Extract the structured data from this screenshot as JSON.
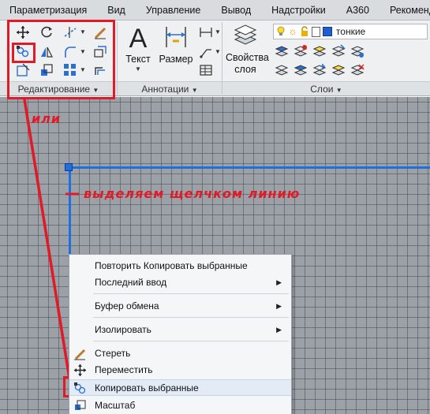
{
  "menubar": {
    "items": [
      "Параметризация",
      "Вид",
      "Управление",
      "Вывод",
      "Надстройки",
      "A360",
      "Рекомендованные"
    ]
  },
  "ribbon": {
    "panels": {
      "edit": {
        "title": "Редактирование"
      },
      "annotations": {
        "title": "Аннотации",
        "text_label": "Текст",
        "dimension_label": "Размер"
      },
      "layers": {
        "title": "Слои",
        "props_label_1": "Свойства",
        "props_label_2": "слоя",
        "current_layer": "тонкие"
      }
    }
  },
  "annotations": {
    "or_text": "или",
    "select_line_text": "выделяем щелчком линию"
  },
  "context_menu": {
    "items": [
      {
        "label": "Повторить Копировать выбранные"
      },
      {
        "label": "Последний ввод"
      },
      {
        "label": "Буфер обмена"
      },
      {
        "label": "Изолировать"
      },
      {
        "label": "Стереть"
      },
      {
        "label": "Переместить"
      },
      {
        "label": "Копировать выбранные"
      },
      {
        "label": "Масштаб"
      }
    ]
  },
  "colors": {
    "annotation_red": "#e01a26",
    "selected_line_blue": "#1f6fe0",
    "layer_color_blue": "#1f5fd1"
  }
}
